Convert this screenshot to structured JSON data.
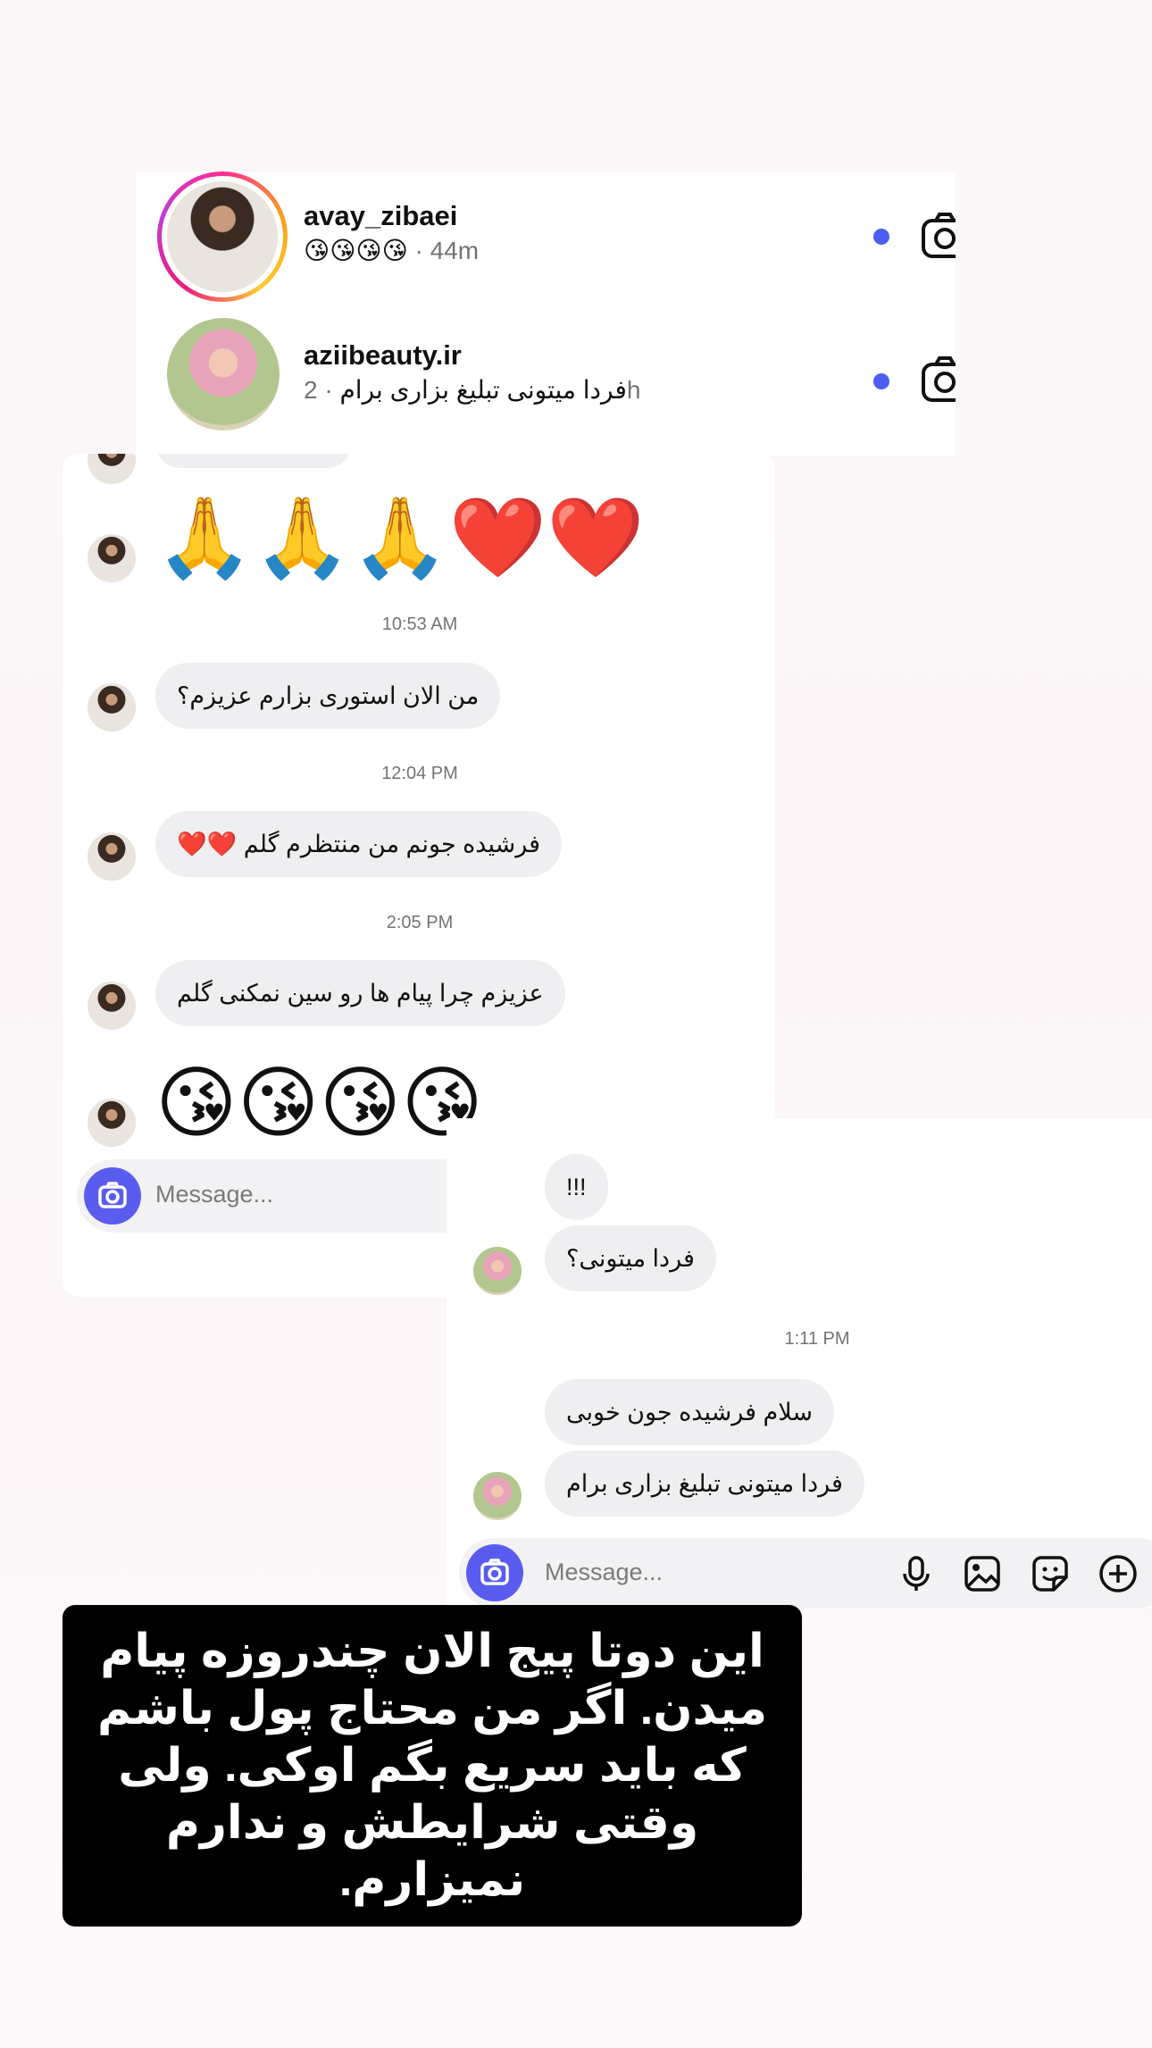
{
  "colors": {
    "accent": "#5a5cf0",
    "unread": "#4c5ef0",
    "bubble": "#efeff1",
    "caption_bg": "#000000"
  },
  "dm_list": [
    {
      "username": "avay_zibaei",
      "preview": "😘😘😘😘",
      "time": "· 44m",
      "has_story_ring": true,
      "unread": true,
      "icon": "camera-icon"
    },
    {
      "username": "aziibeauty.ir",
      "preview": "فردا میتونی تبلیغ بزاری برام",
      "time": "· 2h",
      "has_story_ring": false,
      "unread": true,
      "icon": "camera-icon"
    }
  ],
  "chat_a": {
    "messages": [
      {
        "emoji": "🙏🙏🙏❤️❤️"
      },
      {
        "timestamp": "10:53 AM",
        "text": "من الان استوری بزارم عزیزم؟"
      },
      {
        "timestamp": "12:04 PM",
        "text": "فرشیده جونم من منتظرم گلم ❤️❤️"
      },
      {
        "timestamp": "2:05 PM",
        "text": "عزیزم چرا پیام ها رو سین نمکنی گلم"
      },
      {
        "emoji": "😘😘😘😘"
      }
    ],
    "composer_placeholder": "Message..."
  },
  "chat_b": {
    "messages": [
      {
        "text": "!!!"
      },
      {
        "text": "فردا میتونی؟"
      },
      {
        "timestamp": "1:11 PM",
        "text": "سلام فرشیده جون خوبی"
      },
      {
        "text": "فردا میتونی تبلیغ بزاری برام"
      }
    ],
    "composer_placeholder": "Message...",
    "composer_icons": [
      "microphone-icon",
      "gallery-icon",
      "sticker-icon",
      "plus-icon"
    ]
  },
  "caption": "این دوتا پیج الان چندروزه پیام میدن. اگر من محتاج پول باشم که باید سریع بگم اوکی. ولی وقتی شرایطش و ندارم نمیزارم."
}
